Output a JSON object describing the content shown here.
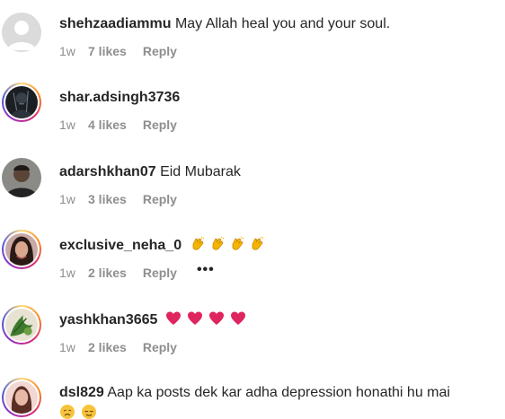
{
  "comments": [
    {
      "username": "shehzaadiammu",
      "text": "May Allah heal you and your soul.",
      "time": "1w",
      "likes": "7 likes",
      "reply": "Reply"
    },
    {
      "username": "shar.adsingh3736",
      "text": "",
      "time": "1w",
      "likes": "4 likes",
      "reply": "Reply"
    },
    {
      "username": "adarshkhan07",
      "text": "Eid Mubarak",
      "time": "1w",
      "likes": "3 likes",
      "reply": "Reply"
    },
    {
      "username": "exclusive_neha_0",
      "text": "",
      "emojis": [
        "clapping-hands",
        "clapping-hands",
        "clapping-hands",
        "clapping-hands"
      ],
      "time": "1w",
      "likes": "2 likes",
      "reply": "Reply",
      "more": "•••"
    },
    {
      "username": "yashkhan3665",
      "text": "",
      "emojis": [
        "red-heart",
        "red-heart",
        "red-heart",
        "red-heart"
      ],
      "time": "1w",
      "likes": "2 likes",
      "reply": "Reply"
    },
    {
      "username": "dsl829",
      "text": "Aap ka posts dek kar adha depression honathi hu mai",
      "emojis": [
        "disappointed-face",
        "relieved-face"
      ]
    }
  ],
  "colors": {
    "text": "#262626",
    "meta": "#8e8e8e",
    "heart": "#e0245e",
    "clap": "#f4b400"
  }
}
